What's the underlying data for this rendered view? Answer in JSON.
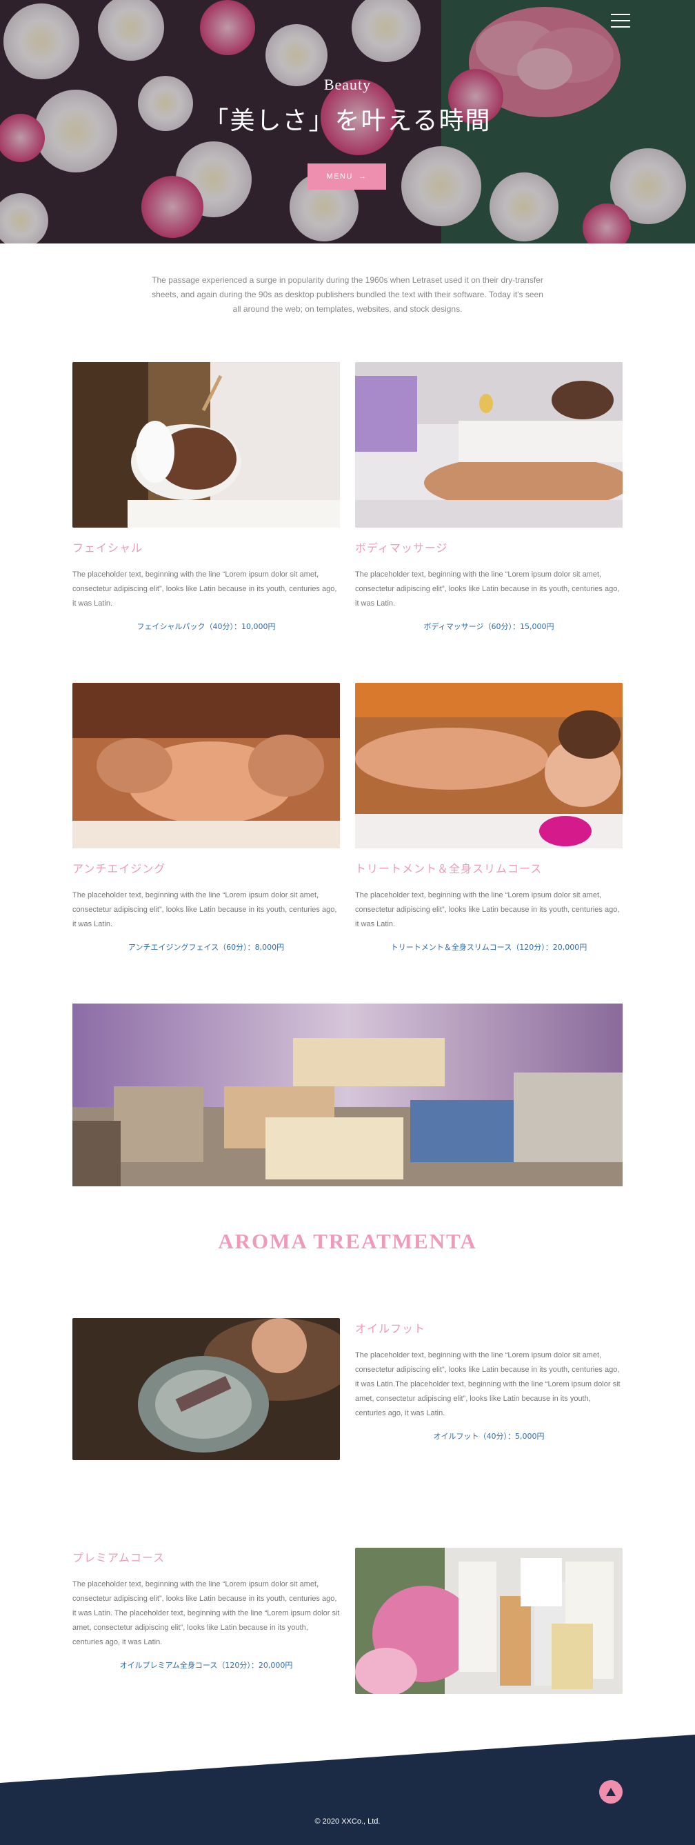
{
  "hero": {
    "subtitle": "Beauty",
    "title": "「美しさ」を叶える時間",
    "button_label": "MENU",
    "button_arrow": "→"
  },
  "intro": {
    "text": "The passage experienced a surge in popularity during the 1960s when Letraset used it on their dry-transfer sheets, and again during the 90s as desktop publishers bundled the text with their software. Today it's seen all around the web; on templates, websites, and stock designs."
  },
  "services": [
    {
      "title": "フェイシャル",
      "description": "The placeholder text, beginning with the line “Lorem ipsum dolor sit amet, consectetur adipiscing elit”, looks like Latin because in its youth, centuries ago, it was Latin.",
      "price": "フェイシャルパック（40分）：10,000円"
    },
    {
      "title": "ボディマッサージ",
      "description": "The placeholder text, beginning with the line “Lorem ipsum dolor sit amet, consectetur adipiscing elit”, looks like Latin because in its youth, centuries ago, it was Latin.",
      "price": "ボディマッサージ（60分）：15,000円"
    },
    {
      "title": "アンチエイジング",
      "description": "The placeholder text, beginning with the line “Lorem ipsum dolor sit amet, consectetur adipiscing elit”, looks like Latin because in its youth, centuries ago, it was Latin.",
      "price": "アンチエイジングフェイス（60分）：8,000円"
    },
    {
      "title": "トリートメント＆全身スリムコース",
      "description": "The placeholder text, beginning with the line “Lorem ipsum dolor sit amet, consectetur adipiscing elit”, looks like Latin because in its youth, centuries ago, it was Latin.",
      "price": "トリートメント＆全身スリムコース（120分）：20,000円"
    }
  ],
  "aroma": {
    "title": "AROMA TREATMENTA",
    "items": [
      {
        "title": "オイルフット",
        "description": "The placeholder text, beginning with the line “Lorem ipsum dolor sit amet, consectetur adipiscing elit”, looks like Latin because in its youth, centuries ago, it was Latin.The placeholder text, beginning with the line “Lorem ipsum dolor sit amet, consectetur adipiscing elit”, looks like Latin because in its youth, centuries ago, it was Latin.",
        "price": "オイルフット（40分）：5,000円"
      },
      {
        "title": "プレミアムコース",
        "description": "The placeholder text, beginning with the line “Lorem ipsum dolor sit amet, consectetur adipiscing elit”, looks like Latin because in its youth, centuries ago, it was Latin. The placeholder text, beginning with the line “Lorem ipsum dolor sit amet, consectetur adipiscing elit”, looks like Latin because in its youth, centuries ago, it was Latin.",
        "price": "オイルプレミアム全身コース（120分）：20,000円"
      }
    ]
  },
  "footer": {
    "copyright": "© 2020 XXCo., Ltd."
  },
  "icons": {
    "menu": "hamburger-icon",
    "arrow": "arrow-right-icon",
    "top": "triangle-up-icon"
  },
  "colors": {
    "accent_pink": "#ee9ab8",
    "button_pink": "#ef8fb0",
    "price_blue": "#2d6cb2",
    "footer_navy": "#1c2b45"
  }
}
